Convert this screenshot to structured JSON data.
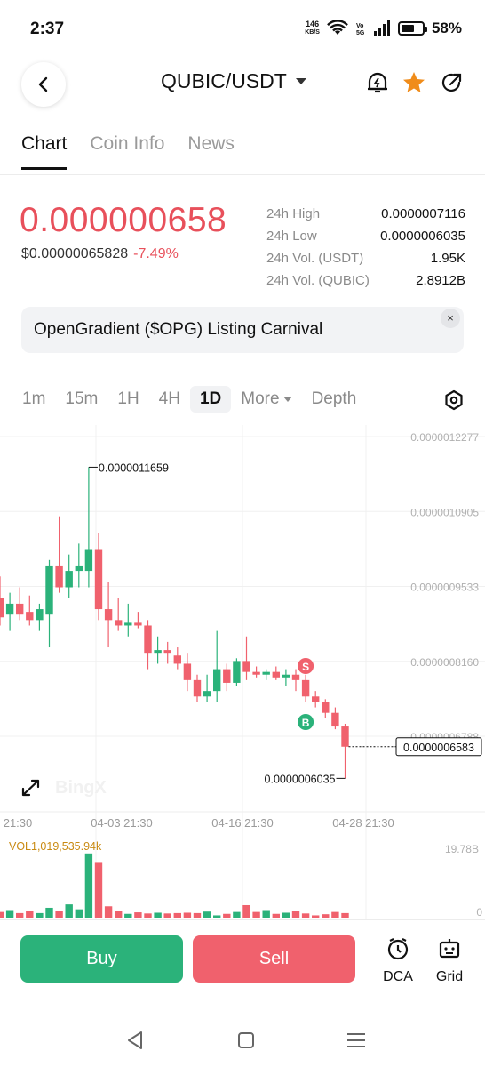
{
  "status_bar": {
    "time": "2:37",
    "net_speed_value": "146",
    "net_speed_unit": "KB/S",
    "battery": "58%",
    "battery_level": 0.58
  },
  "header": {
    "pair": "QUBIC/USDT",
    "accent_color": "#f08c1a"
  },
  "tabs": [
    {
      "label": "Chart",
      "active": true
    },
    {
      "label": "Coin Info",
      "active": false
    },
    {
      "label": "News",
      "active": false
    }
  ],
  "price": {
    "last": "0.000000658",
    "usd": "$0.00000065828",
    "change": "-7.49%",
    "down_color": "#e8505b"
  },
  "stats": [
    {
      "label": "24h High",
      "value": "0.0000007116"
    },
    {
      "label": "24h Low",
      "value": "0.0000006035"
    },
    {
      "label": "24h Vol. (USDT)",
      "value": "1.95K"
    },
    {
      "label": "24h Vol. (QUBIC)",
      "value": "2.8912B"
    }
  ],
  "banner": {
    "text": "OpenGradient ($OPG) Listing Carnival",
    "close": "×"
  },
  "intervals": [
    {
      "label": "1m",
      "active": false
    },
    {
      "label": "15m",
      "active": false
    },
    {
      "label": "1H",
      "active": false
    },
    {
      "label": "4H",
      "active": false
    },
    {
      "label": "1D",
      "active": true
    },
    {
      "label": "More",
      "active": false
    },
    {
      "label": "Depth",
      "active": false
    }
  ],
  "chart_data": {
    "type": "candlestick",
    "interval": "1D",
    "y_ticks": [
      "0.0000012277",
      "0.0000010905",
      "0.0000009533",
      "0.0000008160",
      "0.0000006788"
    ],
    "ylim": [
      5.8e-07,
      1.26e-06
    ],
    "x_ticks": [
      "21:30",
      "04-03 21:30",
      "04-16 21:30",
      "04-28 21:30"
    ],
    "grid": true,
    "current_price_label": "0.0000006583",
    "max_label": "0.0000011659",
    "min_label": "0.0000006035",
    "signals": [
      {
        "label": "S",
        "type": "sell",
        "color": "#f0616d"
      },
      {
        "label": "B",
        "type": "buy",
        "color": "#2bb27a"
      }
    ],
    "watermark": "BingX",
    "up_color": "#2bb27a",
    "down_color": "#f0616d",
    "candles": [
      {
        "o": 9.3e-07,
        "h": 9.7e-07,
        "l": 8.8e-07,
        "c": 8.95e-07
      },
      {
        "o": 9e-07,
        "h": 9.4e-07,
        "l": 8.7e-07,
        "c": 9.2e-07
      },
      {
        "o": 9.2e-07,
        "h": 9.5e-07,
        "l": 8.9e-07,
        "c": 9e-07
      },
      {
        "o": 9.05e-07,
        "h": 9.35e-07,
        "l": 8.8e-07,
        "c": 8.9e-07
      },
      {
        "o": 8.9e-07,
        "h": 9.2e-07,
        "l": 8.7e-07,
        "c": 9.1e-07
      },
      {
        "o": 9e-07,
        "h": 1e-06,
        "l": 8.4e-07,
        "c": 9.9e-07
      },
      {
        "o": 9.9e-07,
        "h": 1.08e-06,
        "l": 9.4e-07,
        "c": 9.5e-07
      },
      {
        "o": 9.5e-07,
        "h": 1.01e-06,
        "l": 9.3e-07,
        "c": 9.8e-07
      },
      {
        "o": 9.8e-07,
        "h": 1.03e-06,
        "l": 9.5e-07,
        "c": 9.9e-07
      },
      {
        "o": 9.8e-07,
        "h": 1.17e-06,
        "l": 9.5e-07,
        "c": 1.02e-06
      },
      {
        "o": 1.02e-06,
        "h": 1.05e-06,
        "l": 8.9e-07,
        "c": 9.1e-07
      },
      {
        "o": 9.1e-07,
        "h": 9.6e-07,
        "l": 8.4e-07,
        "c": 8.9e-07
      },
      {
        "o": 8.9e-07,
        "h": 9.3e-07,
        "l": 8.7e-07,
        "c": 8.8e-07
      },
      {
        "o": 8.8e-07,
        "h": 9.2e-07,
        "l": 8.6e-07,
        "c": 8.85e-07
      },
      {
        "o": 8.85e-07,
        "h": 9.05e-07,
        "l": 8.75e-07,
        "c": 8.8e-07
      },
      {
        "o": 8.8e-07,
        "h": 8.9e-07,
        "l": 8e-07,
        "c": 8.3e-07
      },
      {
        "o": 8.3e-07,
        "h": 8.6e-07,
        "l": 8.1e-07,
        "c": 8.35e-07
      },
      {
        "o": 8.35e-07,
        "h": 8.5e-07,
        "l": 8.1e-07,
        "c": 8.3e-07
      },
      {
        "o": 8.25e-07,
        "h": 8.4e-07,
        "l": 8e-07,
        "c": 8.1e-07
      },
      {
        "o": 8.1e-07,
        "h": 8.3e-07,
        "l": 7.6e-07,
        "c": 7.8e-07
      },
      {
        "o": 7.8e-07,
        "h": 7.9e-07,
        "l": 7.4e-07,
        "c": 7.5e-07
      },
      {
        "o": 7.5e-07,
        "h": 7.9e-07,
        "l": 7.4e-07,
        "c": 7.6e-07
      },
      {
        "o": 7.6e-07,
        "h": 8.7e-07,
        "l": 7.4e-07,
        "c": 8e-07
      },
      {
        "o": 8e-07,
        "h": 8.1e-07,
        "l": 7.6e-07,
        "c": 7.75e-07
      },
      {
        "o": 7.75e-07,
        "h": 8.2e-07,
        "l": 7.7e-07,
        "c": 8.15e-07
      },
      {
        "o": 8.15e-07,
        "h": 8.6e-07,
        "l": 7.8e-07,
        "c": 7.95e-07
      },
      {
        "o": 7.95e-07,
        "h": 8.05e-07,
        "l": 7.85e-07,
        "c": 7.9e-07
      },
      {
        "o": 7.9e-07,
        "h": 8e-07,
        "l": 7.8e-07,
        "c": 7.95e-07
      },
      {
        "o": 7.95e-07,
        "h": 8.05e-07,
        "l": 7.8e-07,
        "c": 7.85e-07
      },
      {
        "o": 7.85e-07,
        "h": 8e-07,
        "l": 7.7e-07,
        "c": 7.9e-07
      },
      {
        "o": 7.9e-07,
        "h": 8e-07,
        "l": 7.6e-07,
        "c": 7.8e-07
      },
      {
        "o": 7.8e-07,
        "h": 7.9e-07,
        "l": 7.4e-07,
        "c": 7.5e-07
      },
      {
        "o": 7.5e-07,
        "h": 7.6e-07,
        "l": 7.3e-07,
        "c": 7.4e-07
      },
      {
        "o": 7.4e-07,
        "h": 7.45e-07,
        "l": 7.1e-07,
        "c": 7.2e-07
      },
      {
        "o": 7.2e-07,
        "h": 7.3e-07,
        "l": 6.9e-07,
        "c": 6.95e-07
      },
      {
        "o": 6.95e-07,
        "h": 7e-07,
        "l": 6e-07,
        "c": 6.58e-07
      }
    ],
    "volume": {
      "label": "VOL1,019,535.94k",
      "ylim_label": "19.78B",
      "zero_label": "0",
      "max": 19780000000,
      "values": [
        1500000000,
        2000000000,
        1200000000,
        1800000000,
        1200000000,
        2600000000,
        1700000000,
        3500000000,
        2200000000,
        17000000000,
        14500000000,
        3000000000,
        1800000000,
        1000000000,
        1400000000,
        1100000000,
        1300000000,
        1100000000,
        1200000000,
        1300000000,
        1200000000,
        1600000000,
        600000000,
        1000000000,
        1500000000,
        3300000000,
        1500000000,
        2000000000,
        1000000000,
        1300000000,
        1700000000,
        1100000000,
        600000000,
        900000000,
        1500000000,
        1200000000
      ]
    }
  },
  "actions": {
    "buy": "Buy",
    "sell": "Sell",
    "dca": "DCA",
    "grid": "Grid"
  },
  "colors": {
    "buy": "#2bb27a",
    "sell": "#f0616d"
  }
}
